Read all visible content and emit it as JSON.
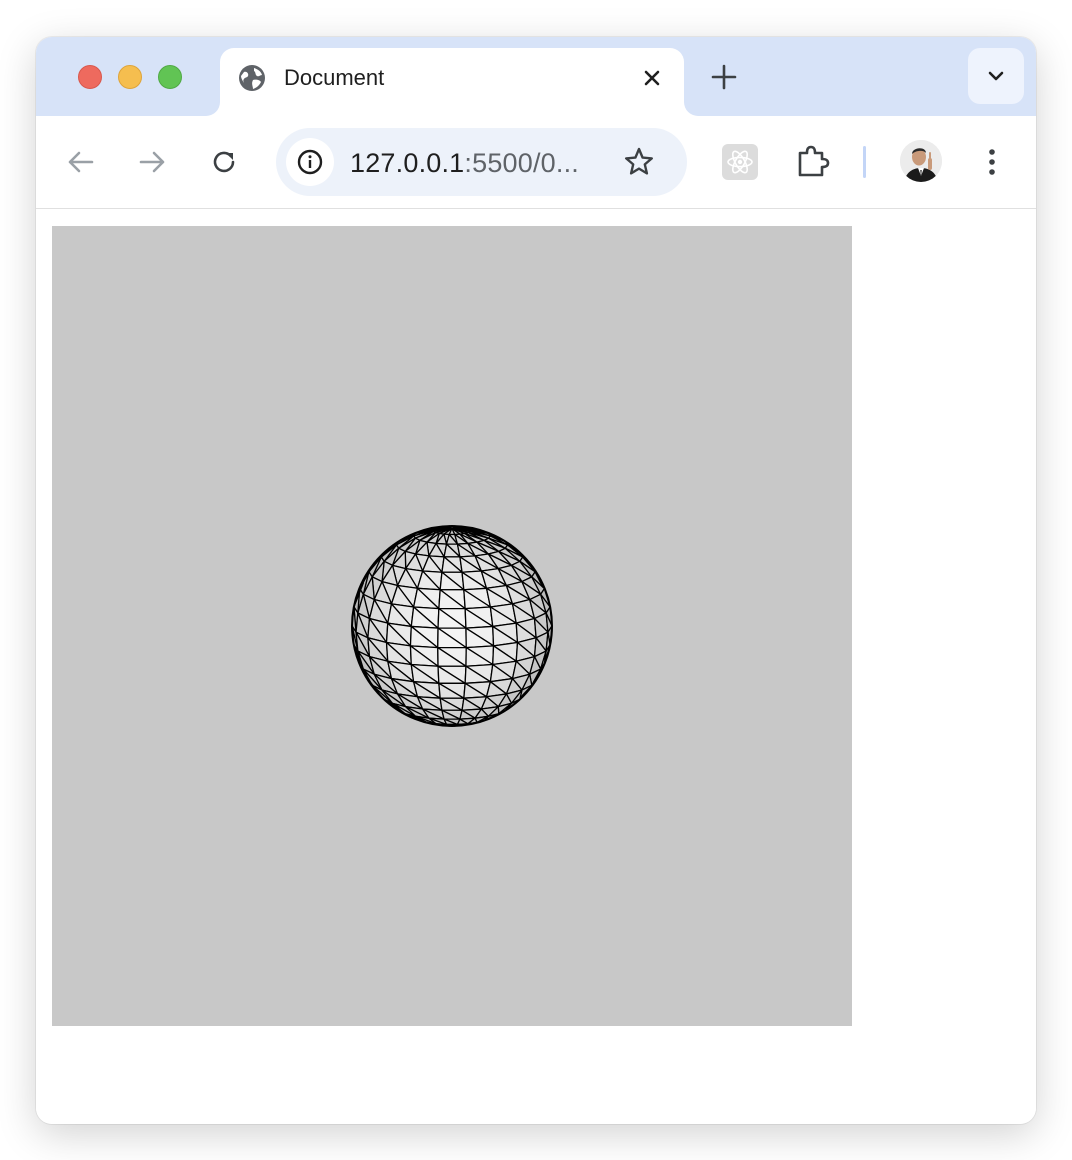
{
  "browser": {
    "tab": {
      "title": "Document",
      "favicon_icon": "globe-icon",
      "close_icon": "close-icon"
    },
    "new_tab_icon": "plus-icon",
    "tab_search_icon": "chevron-down-icon",
    "toolbar": {
      "back_icon": "arrow-left-icon",
      "forward_icon": "arrow-right-icon",
      "reload_icon": "reload-icon",
      "site_info_icon": "info-icon",
      "url_host": "127.0.0.1",
      "url_rest": ":5500/0...",
      "bookmark_icon": "star-icon",
      "extensions": [
        "react-devtools-icon",
        "puzzle-icon"
      ],
      "profile_icon": "avatar",
      "menu_icon": "kebab-menu-icon"
    }
  },
  "page": {
    "canvas": {
      "background": "#c8c8c8",
      "content": "wireframe-sphere",
      "mesh_color": "#000000",
      "surface_color": "#d6d6d6"
    }
  },
  "colors": {
    "tabstrip": "#d7e3f8",
    "omnibox": "#edf2fa",
    "traffic_red": "#ee6a5e",
    "traffic_yellow": "#f5be4f",
    "traffic_green": "#61c454"
  }
}
